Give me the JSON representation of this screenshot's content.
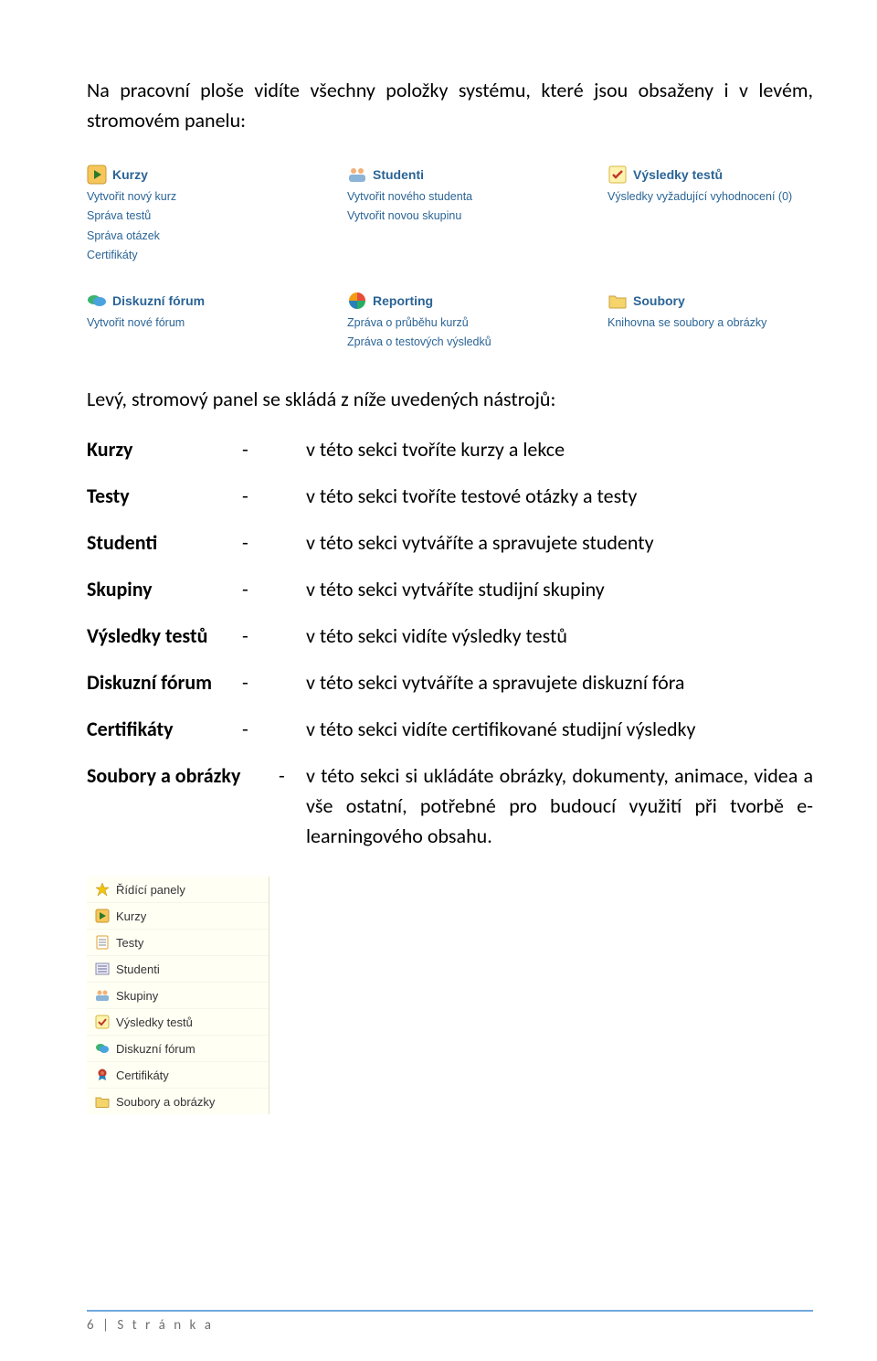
{
  "intro": "Na pracovní ploše vidíte všechny položky systému, které jsou obsaženy i v levém, stromovém panelu:",
  "dashboard_row1": [
    {
      "icon": "play-icon",
      "title": "Kurzy",
      "subs": [
        "Vytvořit nový kurz",
        "Správa testů",
        "Správa otázek",
        "Certifikáty"
      ]
    },
    {
      "icon": "people-icon",
      "title": "Studenti",
      "subs": [
        "Vytvořit nového studenta",
        "Vytvořit novou skupinu"
      ]
    },
    {
      "icon": "check-icon",
      "title": "Výsledky testů",
      "subs": [
        "Výsledky vyžadující vyhodnocení (0)"
      ]
    }
  ],
  "dashboard_row2": [
    {
      "icon": "chat-icon",
      "title": "Diskuzní fórum",
      "subs": [
        "Vytvořit nové fórum"
      ]
    },
    {
      "icon": "chart-icon",
      "title": "Reporting",
      "subs": [
        "Zpráva o průběhu kurzů",
        "Zpráva o testových výsledků"
      ]
    },
    {
      "icon": "folder-icon",
      "title": "Soubory",
      "subs": [
        "Knihovna se soubory a obrázky"
      ]
    }
  ],
  "section_title": "Levý, stromový panel se skládá z níže uvedených nástrojů:",
  "defs": [
    {
      "term": "Kurzy",
      "desc": "v této sekci tvoříte kurzy a lekce"
    },
    {
      "term": "Testy",
      "desc": "v této sekci tvoříte testové otázky a testy"
    },
    {
      "term": "Studenti",
      "desc": "v této sekci vytváříte a spravujete studenty"
    },
    {
      "term": "Skupiny",
      "desc": "v této sekci vytváříte studijní skupiny"
    },
    {
      "term": "Výsledky testů",
      "desc": "v této sekci vidíte výsledky testů"
    },
    {
      "term": "Diskuzní fórum",
      "desc": "v této sekci vytváříte a spravujete diskuzní fóra"
    },
    {
      "term": "Certifikáty",
      "desc": "v této sekci vidíte certifikované studijní výsledky"
    },
    {
      "term": "Soubory a obrázky",
      "desc": "v této sekci si ukládáte obrázky, dokumenty, animace, videa a vše ostatní, potřebné pro budoucí využití při tvorbě e-learningového obsahu."
    }
  ],
  "tree": [
    {
      "icon": "star-icon",
      "label": "Řídící panely"
    },
    {
      "icon": "play-icon-sm",
      "label": "Kurzy"
    },
    {
      "icon": "page-icon",
      "label": "Testy"
    },
    {
      "icon": "list-icon",
      "label": "Studenti"
    },
    {
      "icon": "people-icon-sm",
      "label": "Skupiny"
    },
    {
      "icon": "check-icon-sm",
      "label": "Výsledky testů"
    },
    {
      "icon": "chat-icon-sm",
      "label": "Diskuzní fórum"
    },
    {
      "icon": "badge-icon",
      "label": "Certifikáty"
    },
    {
      "icon": "folder-icon-sm",
      "label": "Soubory a obrázky"
    }
  ],
  "footer": {
    "page_no": "6",
    "sep": " | ",
    "label": "S t r á n k a"
  }
}
